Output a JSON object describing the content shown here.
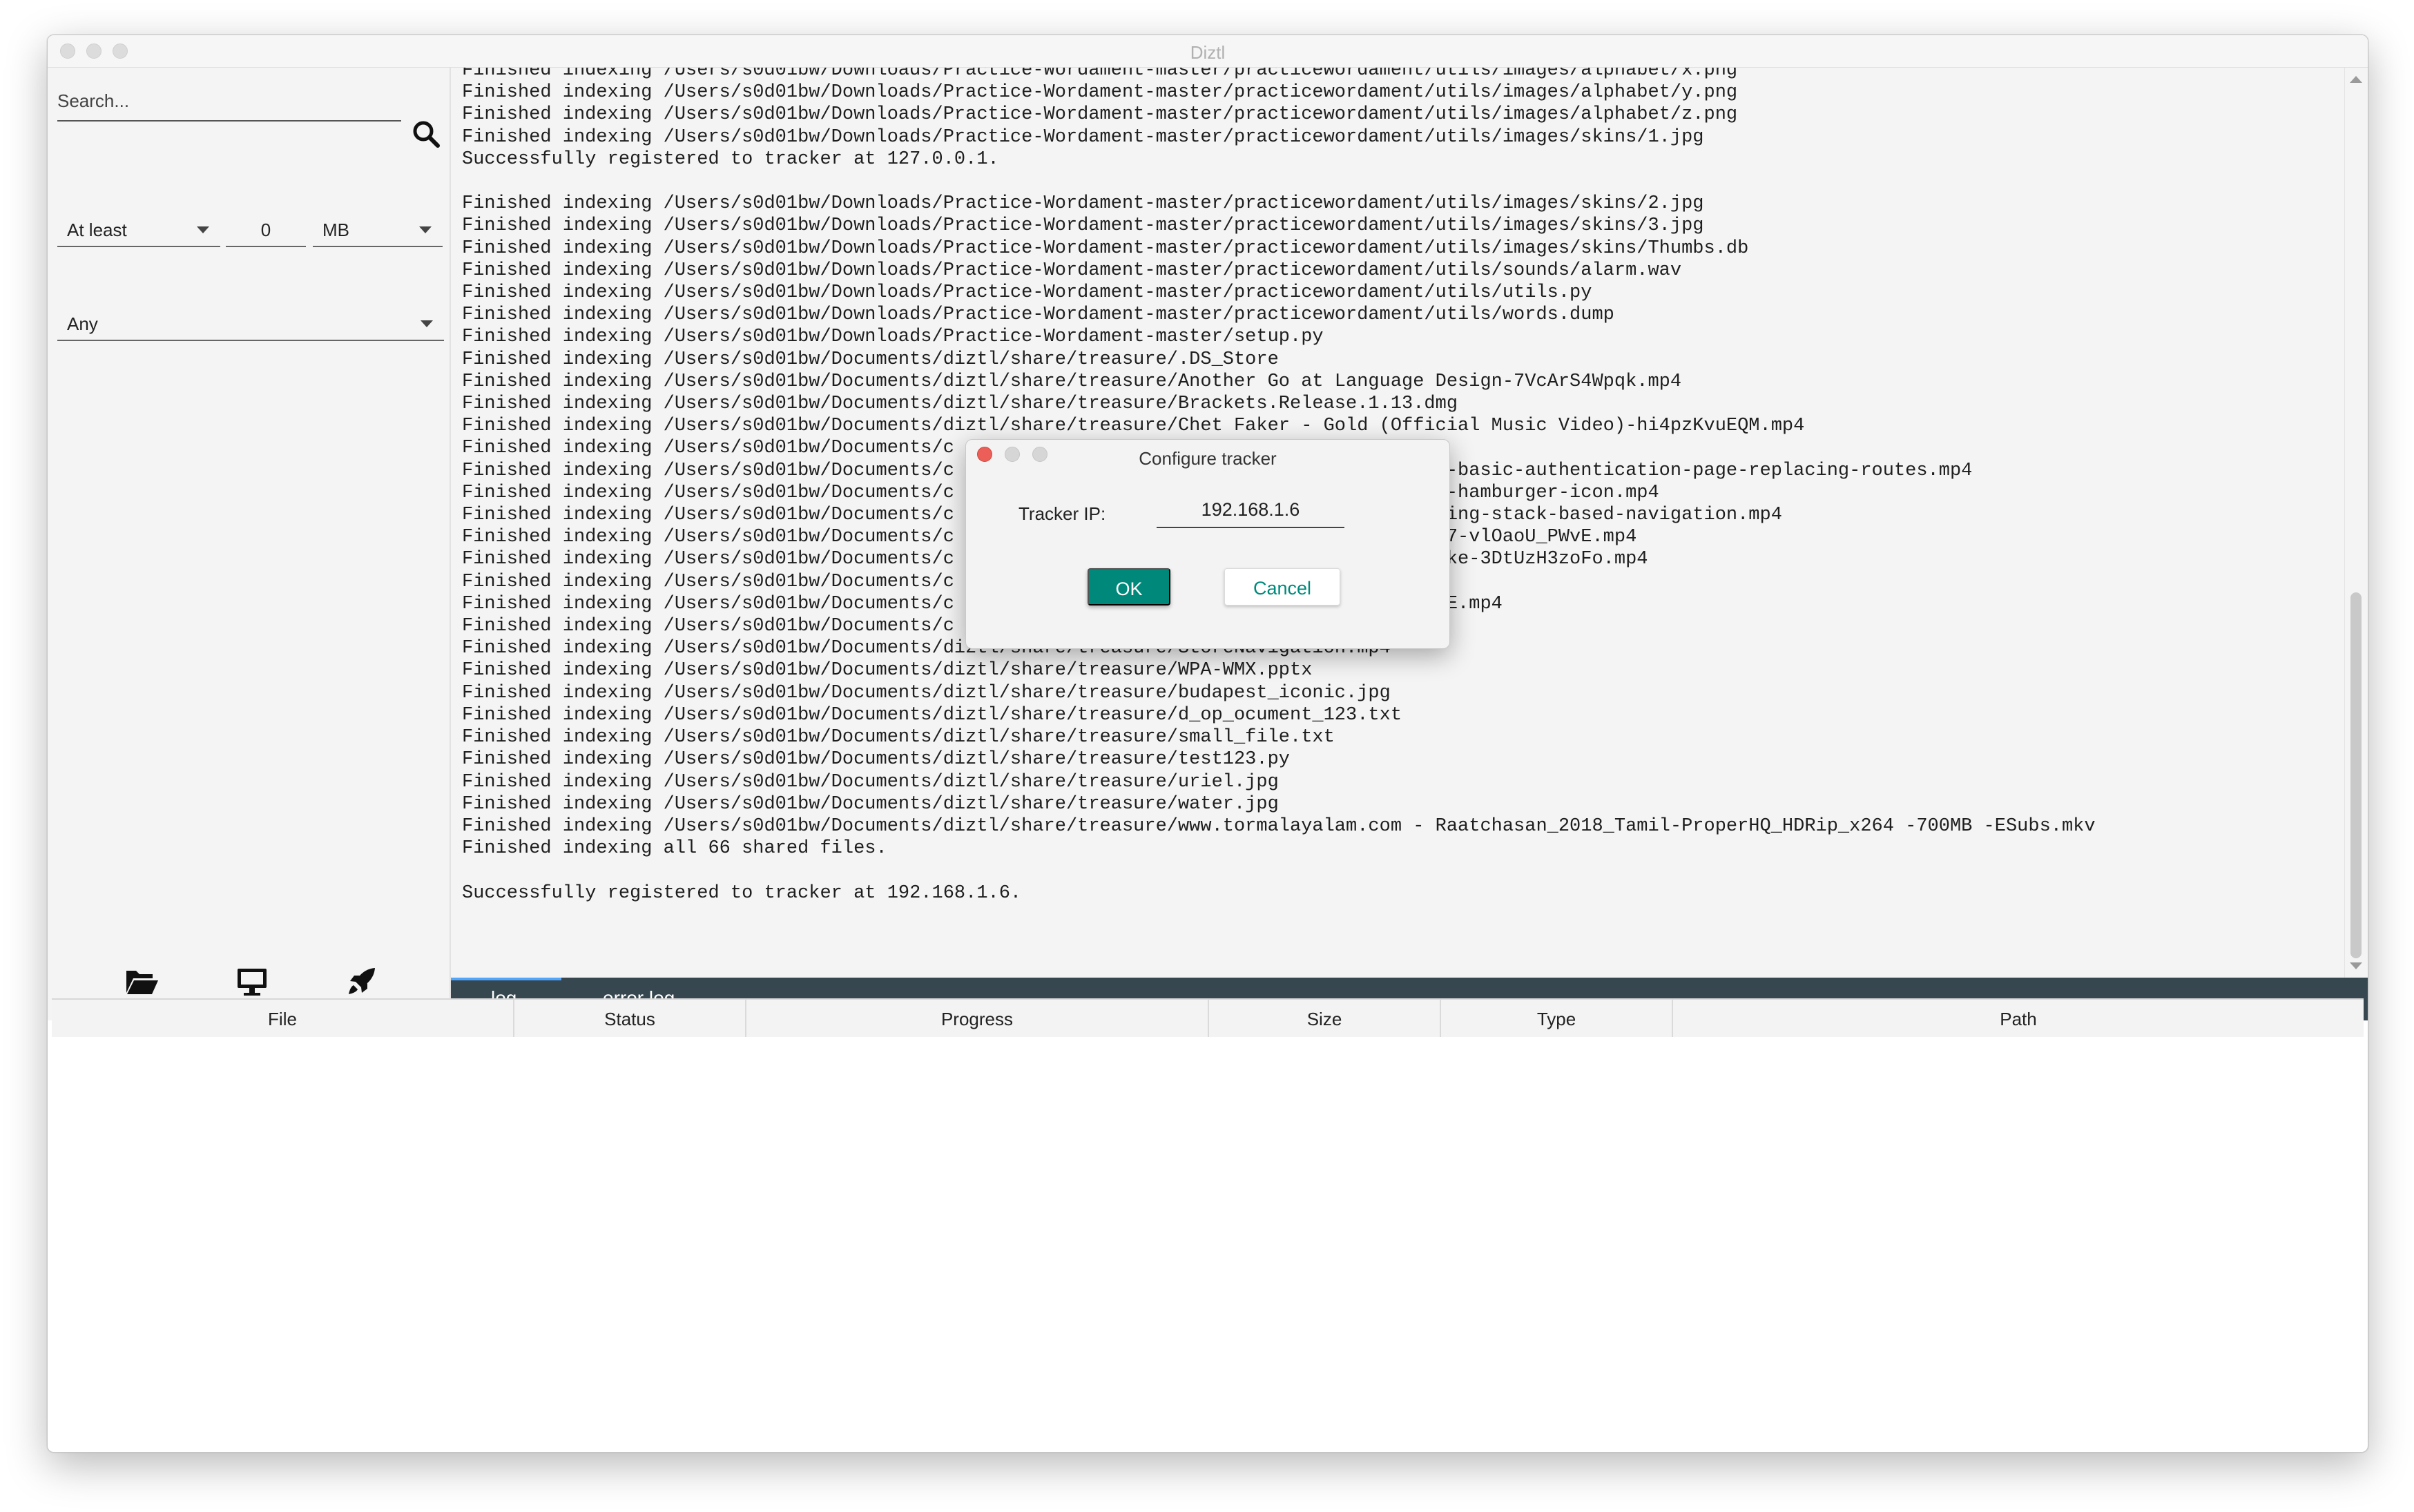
{
  "window": {
    "title": "Diztl"
  },
  "sidebar": {
    "search_placeholder": "Search...",
    "size_filter": {
      "comparator": "At least",
      "value": "0",
      "unit": "MB"
    },
    "type_filter": "Any",
    "icons": [
      "folder-open-icon",
      "monitor-icon",
      "rocket-icon"
    ]
  },
  "log": {
    "lines": [
      "Finished indexing /Users/s0d01bw/Downloads/Practice-Wordament-master/practicewordament/utils/images/alphabet/x.png",
      "Finished indexing /Users/s0d01bw/Downloads/Practice-Wordament-master/practicewordament/utils/images/alphabet/y.png",
      "Finished indexing /Users/s0d01bw/Downloads/Practice-Wordament-master/practicewordament/utils/images/alphabet/z.png",
      "Finished indexing /Users/s0d01bw/Downloads/Practice-Wordament-master/practicewordament/utils/images/skins/1.jpg",
      "Successfully registered to tracker at 127.0.0.1.",
      "",
      "Finished indexing /Users/s0d01bw/Downloads/Practice-Wordament-master/practicewordament/utils/images/skins/2.jpg",
      "Finished indexing /Users/s0d01bw/Downloads/Practice-Wordament-master/practicewordament/utils/images/skins/3.jpg",
      "Finished indexing /Users/s0d01bw/Downloads/Practice-Wordament-master/practicewordament/utils/images/skins/Thumbs.db",
      "Finished indexing /Users/s0d01bw/Downloads/Practice-Wordament-master/practicewordament/utils/sounds/alarm.wav",
      "Finished indexing /Users/s0d01bw/Downloads/Practice-Wordament-master/practicewordament/utils/utils.py",
      "Finished indexing /Users/s0d01bw/Downloads/Practice-Wordament-master/practicewordament/utils/words.dump",
      "Finished indexing /Users/s0d01bw/Downloads/Practice-Wordament-master/setup.py",
      "Finished indexing /Users/s0d01bw/Documents/diztl/share/treasure/.DS_Store",
      "Finished indexing /Users/s0d01bw/Documents/diztl/share/treasure/Another Go at Language Design-7VcArS4Wpqk.mp4",
      "Finished indexing /Users/s0d01bw/Documents/diztl/share/treasure/Brackets.Release.1.13.dmg",
      "Finished indexing /Users/s0d01bw/Documents/diztl/share/treasure/Chet Faker - Gold (Official Music Video)-hi4pzKvuEQM.mp4",
      "Finished indexing /Users/s0d01bw/Documents/c                        Store",
      "Finished indexing /Users/s0d01bw/Documents/c                        gation-09-adding-the-basic-authentication-page-replacing-routes.mp4",
      "Finished indexing /Users/s0d01bw/Documents/c                        gation-10-adding-the-hamburger-icon.mp4",
      "Finished indexing /Users/s0d01bw/Documents/c                        gation-15-understanding-stack-based-navigation.mp4",
      "Finished indexing /Users/s0d01bw/Documents/c                        at Melt Festival 2017-vlOaoU_PWvE.mp4",
      "Finished indexing /Users/s0d01bw/Documents/c                        ency style by Rob Pike-3DtUzH3zoFo.mp4",
      "Finished indexing /Users/s0d01bw/Documents/c",
      "Finished indexing /Users/s0d01bw/Documents/c                        inal Mix)-BzYvtej73HE.mp4",
      "Finished indexing /Users/s0d01bw/Documents/c",
      "Finished indexing /Users/s0d01bw/Documents/diztl/share/treasure/StoreNavigation.mp4",
      "Finished indexing /Users/s0d01bw/Documents/diztl/share/treasure/WPA-WMX.pptx",
      "Finished indexing /Users/s0d01bw/Documents/diztl/share/treasure/budapest_iconic.jpg",
      "Finished indexing /Users/s0d01bw/Documents/diztl/share/treasure/d_op_ocument_123.txt",
      "Finished indexing /Users/s0d01bw/Documents/diztl/share/treasure/small_file.txt",
      "Finished indexing /Users/s0d01bw/Documents/diztl/share/treasure/test123.py",
      "Finished indexing /Users/s0d01bw/Documents/diztl/share/treasure/uriel.jpg",
      "Finished indexing /Users/s0d01bw/Documents/diztl/share/treasure/water.jpg",
      "Finished indexing /Users/s0d01bw/Documents/diztl/share/treasure/www.tormalayalam.com - Raatchasan_2018_Tamil-ProperHQ_HDRip_x264 -700MB -ESubs.mkv",
      "Finished indexing all 66 shared files.",
      "",
      "Successfully registered to tracker at 192.168.1.6."
    ]
  },
  "tabs": [
    {
      "label": "log",
      "active": true
    },
    {
      "label": "error log",
      "active": false
    }
  ],
  "table": {
    "columns": [
      "File",
      "Status",
      "Progress",
      "Size",
      "Type",
      "Path"
    ],
    "rows": []
  },
  "dialog": {
    "title": "Configure tracker",
    "label": "Tracker IP:",
    "value": "192.168.1.6",
    "ok_label": "OK",
    "cancel_label": "Cancel"
  },
  "colors": {
    "accent": "#00897b",
    "tabbar": "#37474f",
    "close_dot": "#ec5f58"
  }
}
